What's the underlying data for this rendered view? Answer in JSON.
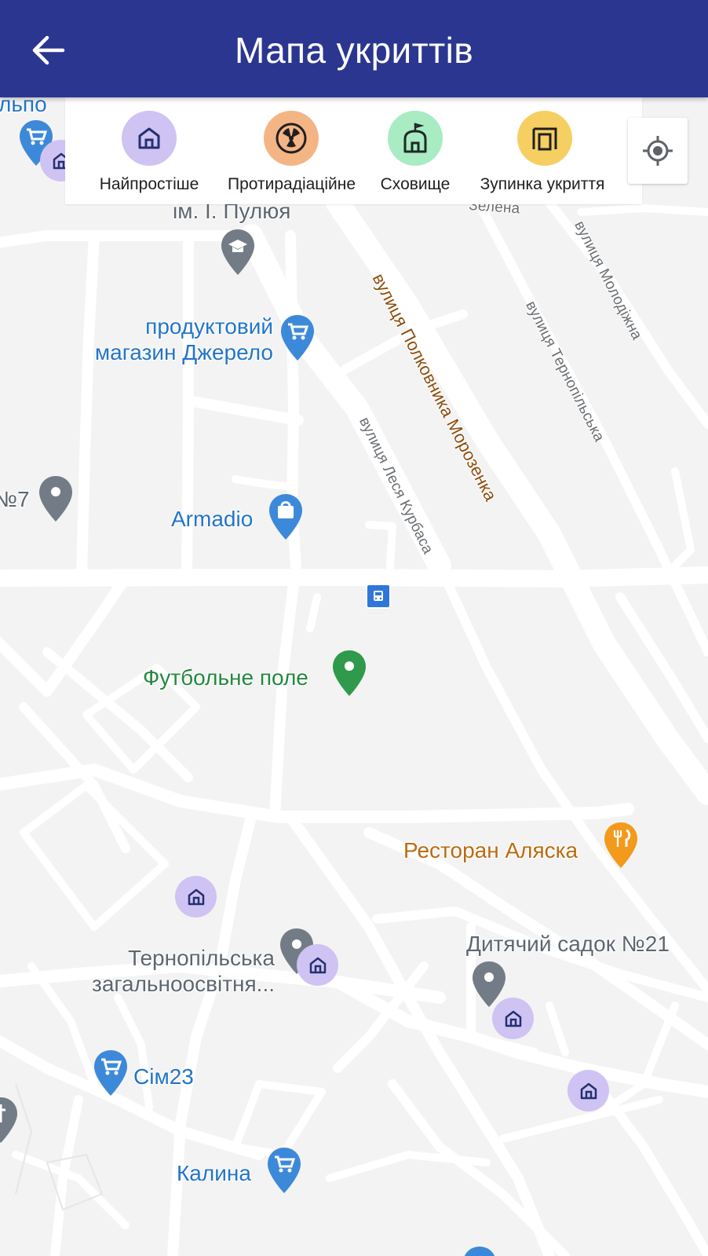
{
  "header": {
    "title": "Мапа укриттів",
    "background": "#2b3690",
    "back_icon": "arrow-left-icon"
  },
  "legend": {
    "items": [
      {
        "label": "Найпростіше",
        "icon": "house-icon",
        "color": "#cfc3f3"
      },
      {
        "label": "Протирадіаційне",
        "icon": "radiation-icon",
        "color": "#f4b585"
      },
      {
        "label": "Сховище",
        "icon": "bunker-flag-icon",
        "color": "#a9ebc3"
      },
      {
        "label": "Зупинка укриття",
        "icon": "stop-shelter-icon",
        "color": "#f6cf63"
      }
    ]
  },
  "map": {
    "location_button_icon": "my-location-icon",
    "streets": [
      "вулиця Полковника Морозенка",
      "вулиця Леся Курбаса",
      "вулиця Тернопільська",
      "вулиця Молодіжна",
      "Зелена"
    ],
    "places": [
      {
        "name": "ім. І. Пулюя",
        "type": "school"
      },
      {
        "name": "продуктовий\nмагазин Джерело",
        "type": "shop"
      },
      {
        "name": "Armadio",
        "type": "shopping"
      },
      {
        "name": "Футбольне поле",
        "type": "park"
      },
      {
        "name": "Ресторан Аляска",
        "type": "restaurant"
      },
      {
        "name": "Тернопільська\nзагальноосвітня...",
        "type": "school"
      },
      {
        "name": "Дитячий садок №21",
        "type": "kindergarten"
      },
      {
        "name": "Сім23",
        "type": "shop"
      },
      {
        "name": "Калина",
        "type": "shop"
      },
      {
        "name": "№7",
        "type": "place"
      },
      {
        "name": "льпо",
        "type": "shop"
      }
    ],
    "shelter_markers": [
      {
        "type": "Найпростіше"
      },
      {
        "type": "Найпростіше"
      },
      {
        "type": "Найпростіше"
      },
      {
        "type": "Найпростіше"
      },
      {
        "type": "Найпростіше"
      },
      {
        "type": "Найпростіше"
      }
    ]
  }
}
